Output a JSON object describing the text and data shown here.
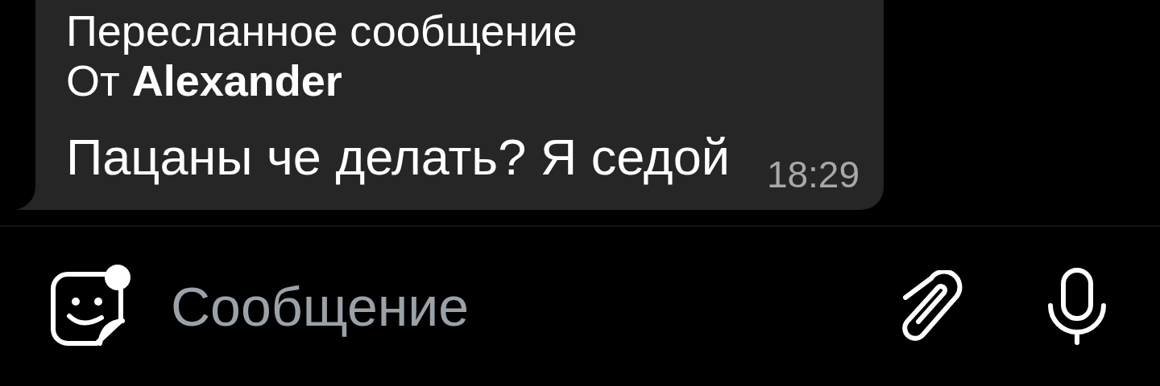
{
  "message": {
    "forwarded_label": "Пересланное сообщение",
    "from_line": "От **Alexander**",
    "text": "Пацаны че делать? Я седой",
    "time": "18:29"
  },
  "composer": {
    "placeholder": "Сообщение",
    "sticker_badge": true
  }
}
